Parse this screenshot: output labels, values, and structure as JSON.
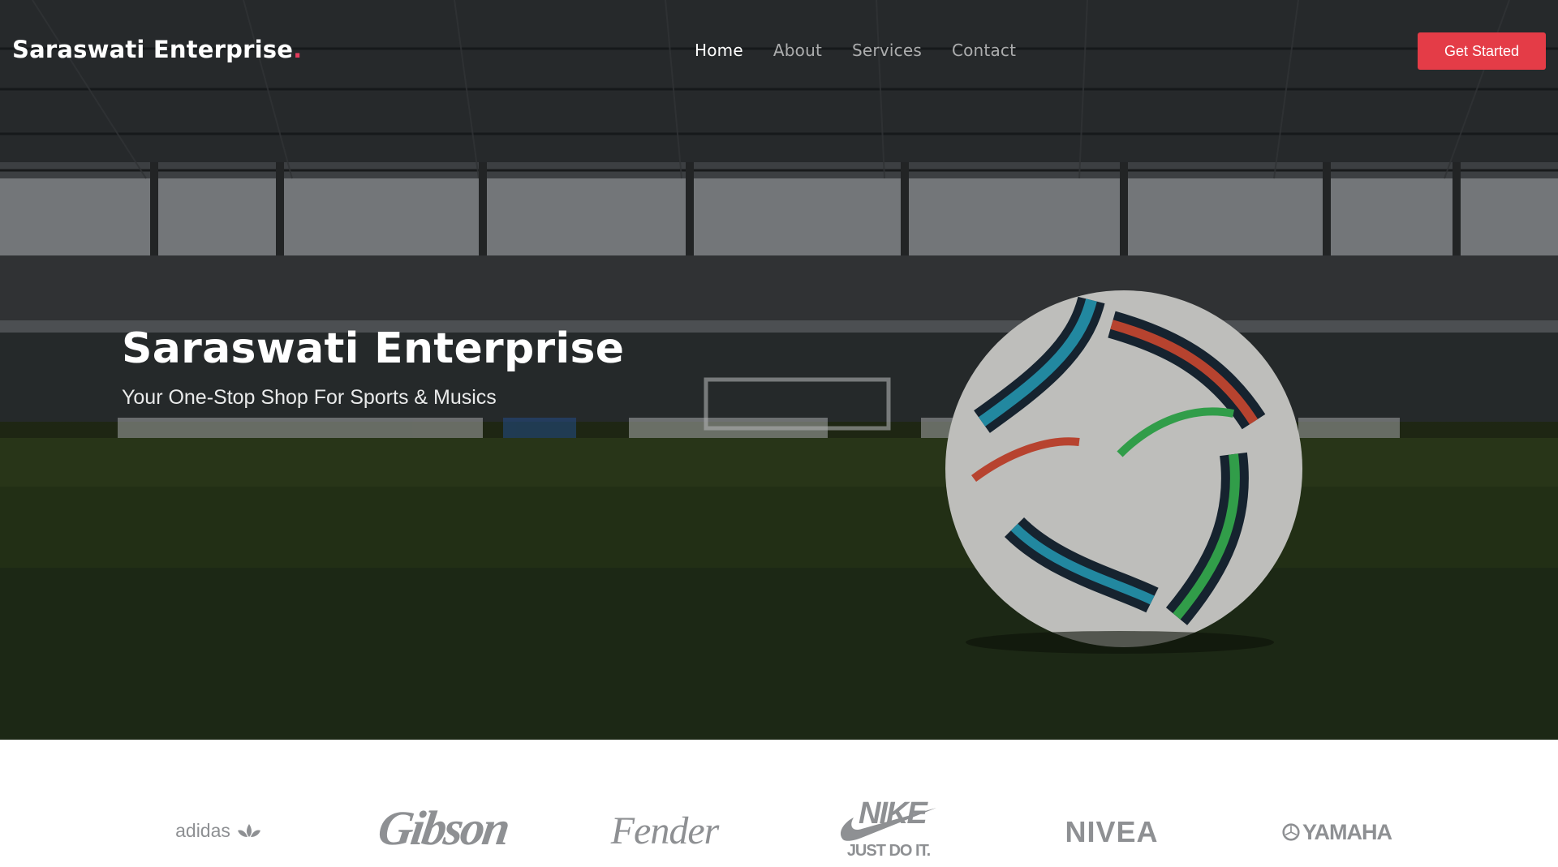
{
  "header": {
    "logo_text": "Saraswati Enterprise",
    "logo_dot": ".",
    "nav": [
      {
        "label": "Home",
        "active": true
      },
      {
        "label": "About",
        "active": false
      },
      {
        "label": "Services",
        "active": false
      },
      {
        "label": "Contact",
        "active": false
      }
    ],
    "cta_label": "Get Started"
  },
  "hero": {
    "title": "Saraswati Enterprise",
    "subtitle": "Your One-Stop Shop For Sports & Musics",
    "background": "stadium-with-soccer-ball-photo"
  },
  "brands": [
    {
      "name": "adidas",
      "icon": "adidas-logo"
    },
    {
      "name": "Gibson",
      "icon": "gibson-logo"
    },
    {
      "name": "Fender",
      "icon": "fender-logo"
    },
    {
      "name": "NIKE",
      "tagline": "JUST DO IT.",
      "icon": "nike-logo"
    },
    {
      "name": "NIVEA",
      "icon": "nivea-logo"
    },
    {
      "name": "YAMAHA",
      "icon": "yamaha-logo"
    }
  ],
  "colors": {
    "accent": "#e43c47",
    "logo_dot": "#e43c5c",
    "brand_gray": "#8e9093"
  }
}
